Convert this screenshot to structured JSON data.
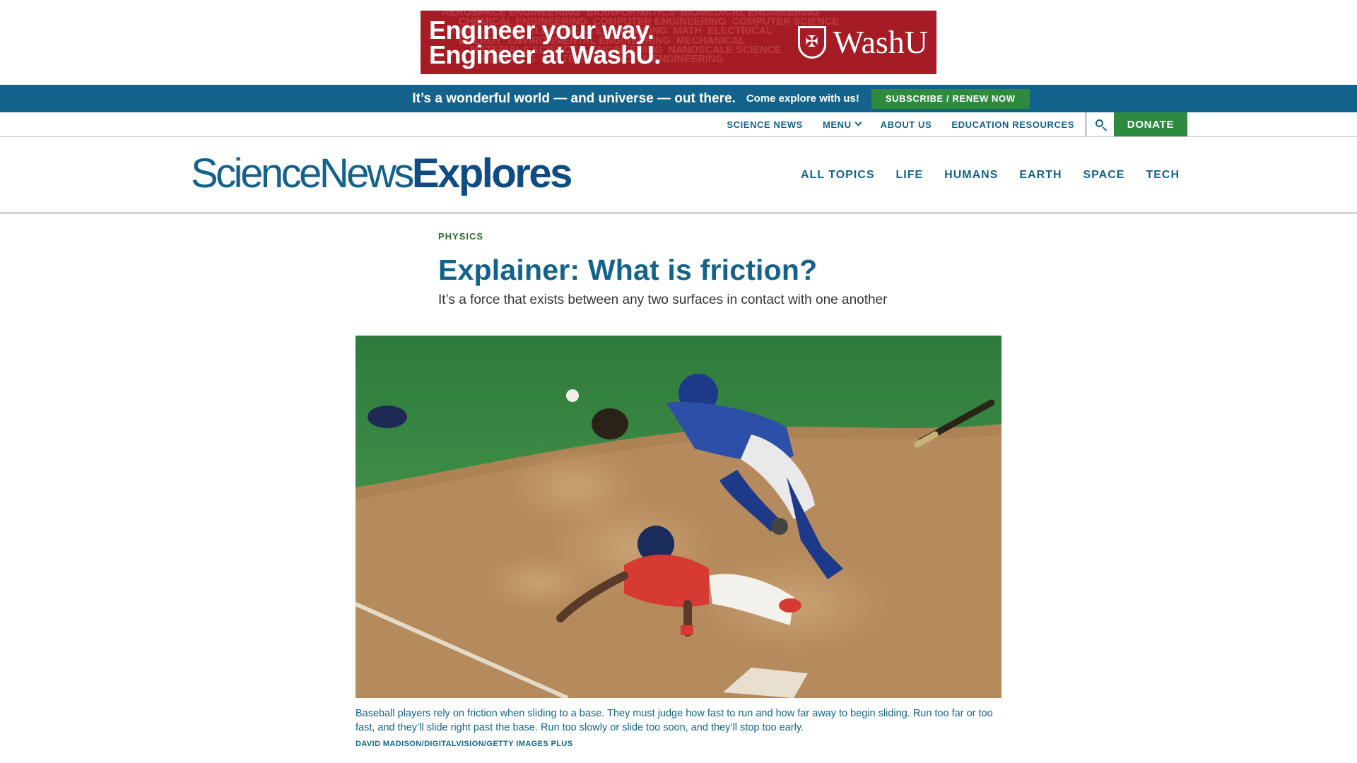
{
  "ad": {
    "headline_line1": "Engineer your way.",
    "headline_line2": "Engineer at WashU.",
    "background_text": "AEROSPACE ENGINEERING  BIOINFORMATICS  BIOMEDICAL ENGINEERING\n      CHEMICAL ENGINEERING  COMPUTER ENGINEERING  COMPUTER SCIENCE\n  DATA SCIENCE  ELECTRICAL ENGINEERING  MATH  ELECTRICAL\n      ENERGY  ENVIRONMENTAL ENGINEERING  MECHANICAL\n          MATERIALS SCIENCE & ENGINEERING  NANOSCALE SCIENCE\n              ROBOTICS  SYSTEMS SCIENCE & ENGINEERING",
    "logo_text": "WashU",
    "logo_icon": "shield-icon",
    "color": "#a51c24"
  },
  "banner": {
    "main": "It’s a wonderful world — and universe — out there.",
    "sub": "Come explore with us!",
    "button": "SUBSCRIBE / RENEW NOW",
    "color": "#13628b",
    "button_color": "#2e8a3f"
  },
  "utility_nav": {
    "items": [
      "SCIENCE NEWS",
      "MENU",
      "ABOUT US",
      "EDUCATION RESOURCES"
    ],
    "menu_icon": "chevron-down-icon",
    "search_icon": "search-icon",
    "donate": "DONATE"
  },
  "header": {
    "logo_part1": "ScienceNews",
    "logo_part2": "Explores",
    "nav": [
      "ALL TOPICS",
      "LIFE",
      "HUMANS",
      "EARTH",
      "SPACE",
      "TECH"
    ]
  },
  "article": {
    "kicker": "PHYSICS",
    "title": "Explainer: What is friction?",
    "dek": "It’s a force that exists between any two surfaces in contact with one another",
    "caption": "Baseball players rely on friction when sliding to a base. They must judge how fast to run and how far away to begin sliding. Run too far or too fast, and they’ll slide right past the base. Run too slowly or slide too soon, and they’ll stop too early.",
    "credit": "DAVID MADISON/DIGITALVISION/GETTY IMAGES PLUS"
  }
}
